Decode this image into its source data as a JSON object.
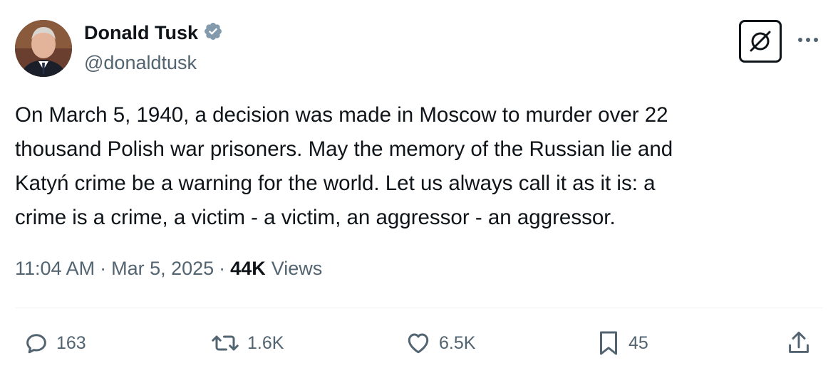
{
  "author": {
    "name": "Donald Tusk",
    "handle": "@donaldtusk",
    "verified_color": "#829aab"
  },
  "header": {
    "grok_icon": "grok-icon",
    "more_icon": "more-icon"
  },
  "tweet": {
    "text": "On March 5, 1940, a decision was made in Moscow to murder over 22\nthousand Polish war prisoners. May the memory of the Russian lie and\nKatyń crime be a warning for the world. Let us always call it as it is: a\ncrime is a crime, a victim - a victim, an aggressor -  an aggressor."
  },
  "meta": {
    "time": "11:04 AM",
    "separator": "·",
    "date": "Mar 5, 2025",
    "views_count": "44K",
    "views_label": "Views"
  },
  "actions": {
    "replies": "163",
    "reposts": "1.6K",
    "likes": "6.5K",
    "bookmarks": "45"
  },
  "colors": {
    "text": "#0f1419",
    "secondary": "#536471",
    "divider": "#eff3f4"
  }
}
